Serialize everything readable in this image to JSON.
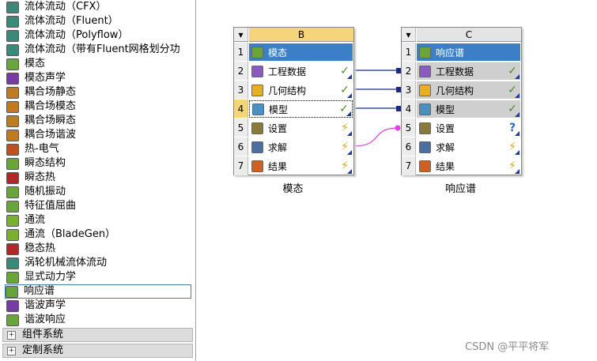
{
  "toolbox": {
    "items": [
      {
        "label": "流体流动（CFX）",
        "icon": "cfx-icon",
        "color": "#3a8a7a"
      },
      {
        "label": "流体流动（Fluent）",
        "icon": "fluent-icon",
        "color": "#3a8a7a"
      },
      {
        "label": "流体流动（Polyflow）",
        "icon": "polyflow-icon",
        "color": "#3a8a7a"
      },
      {
        "label": "流体流动（带有Fluent网格划分功",
        "icon": "fluent-mesh-icon",
        "color": "#3a8a7a"
      },
      {
        "label": "模态",
        "icon": "modal-icon",
        "color": "#6aa53a"
      },
      {
        "label": "模态声学",
        "icon": "modal-acoustics-icon",
        "color": "#7a3aa5"
      },
      {
        "label": "耦合场静态",
        "icon": "coupled-static-icon",
        "color": "#c07a20"
      },
      {
        "label": "耦合场模态",
        "icon": "coupled-modal-icon",
        "color": "#c07a20"
      },
      {
        "label": "耦合场瞬态",
        "icon": "coupled-transient-icon",
        "color": "#c07a20"
      },
      {
        "label": "耦合场谐波",
        "icon": "coupled-harmonic-icon",
        "color": "#c07a20"
      },
      {
        "label": "热-电气",
        "icon": "thermal-electric-icon",
        "color": "#c05020"
      },
      {
        "label": "瞬态结构",
        "icon": "transient-structural-icon",
        "color": "#6aa53a"
      },
      {
        "label": "瞬态热",
        "icon": "transient-thermal-icon",
        "color": "#b02828"
      },
      {
        "label": "随机振动",
        "icon": "random-vibration-icon",
        "color": "#6aa53a"
      },
      {
        "label": "特征值屈曲",
        "icon": "eigenvalue-buckling-icon",
        "color": "#6aa53a"
      },
      {
        "label": "通流",
        "icon": "throughflow-icon",
        "color": "#7ab030"
      },
      {
        "label": "通流（BladeGen）",
        "icon": "throughflow-bladegen-icon",
        "color": "#7ab030"
      },
      {
        "label": "稳态热",
        "icon": "steady-thermal-icon",
        "color": "#b02828"
      },
      {
        "label": "涡轮机械流体流动",
        "icon": "turbomachinery-icon",
        "color": "#3a8a7a"
      },
      {
        "label": "显式动力学",
        "icon": "explicit-dynamics-icon",
        "color": "#6aa53a"
      },
      {
        "label": "响应谱",
        "icon": "response-spectrum-icon",
        "color": "#6aa53a"
      },
      {
        "label": "谐波声学",
        "icon": "harmonic-acoustics-icon",
        "color": "#7a3aa5"
      },
      {
        "label": "谐波响应",
        "icon": "harmonic-response-icon",
        "color": "#6aa53a"
      }
    ],
    "selected_index": 20,
    "groups": [
      {
        "label": "组件系统",
        "expander": "⊞"
      },
      {
        "label": "定制系统",
        "expander": "⊞"
      }
    ]
  },
  "systems": [
    {
      "id": "B",
      "caption": "模态",
      "header_color": "#f5d47a",
      "rows": [
        {
          "num": "1",
          "label": "模态",
          "icon": "modal-icon",
          "status": "",
          "status_color": "",
          "title": true
        },
        {
          "num": "2",
          "label": "工程数据",
          "icon": "engineering-data-icon",
          "status": "✓",
          "status_color": "#4a8a2a"
        },
        {
          "num": "3",
          "label": "几何结构",
          "icon": "geometry-icon",
          "status": "✓",
          "status_color": "#4a8a2a"
        },
        {
          "num": "4",
          "label": "模型",
          "icon": "model-icon",
          "status": "✓",
          "status_color": "#4a8a2a",
          "highlight": true,
          "dotted": true
        },
        {
          "num": "5",
          "label": "设置",
          "icon": "setup-icon",
          "status": "⚡",
          "status_color": "#e0a020"
        },
        {
          "num": "6",
          "label": "求解",
          "icon": "solution-icon",
          "status": "⚡",
          "status_color": "#e0a020"
        },
        {
          "num": "7",
          "label": "结果",
          "icon": "results-icon",
          "status": "⚡",
          "status_color": "#e0a020"
        }
      ]
    },
    {
      "id": "C",
      "caption": "响应谱",
      "header_color": "#e4e4e4",
      "rows": [
        {
          "num": "1",
          "label": "响应谱",
          "icon": "response-spectrum-icon",
          "status": "",
          "status_color": "",
          "title": true
        },
        {
          "num": "2",
          "label": "工程数据",
          "icon": "engineering-data-icon",
          "status": "✓",
          "status_color": "#4a8a2a",
          "shared": true
        },
        {
          "num": "3",
          "label": "几何结构",
          "icon": "geometry-icon",
          "status": "✓",
          "status_color": "#4a8a2a",
          "shared": true
        },
        {
          "num": "4",
          "label": "模型",
          "icon": "model-icon",
          "status": "✓",
          "status_color": "#4a8a2a",
          "shared": true
        },
        {
          "num": "5",
          "label": "设置",
          "icon": "setup-icon",
          "status": "?",
          "status_color": "#2a6ad0"
        },
        {
          "num": "6",
          "label": "求解",
          "icon": "solution-icon",
          "status": "⚡",
          "status_color": "#e0a020"
        },
        {
          "num": "7",
          "label": "结果",
          "icon": "results-icon",
          "status": "⚡",
          "status_color": "#e0a020"
        }
      ]
    }
  ],
  "colors": {
    "title_row": "#3c7fc7",
    "shared_row": "#cfcfcf",
    "link_line": "#1e2a8a",
    "solution_link": "#e040e0"
  },
  "watermark": "CSDN @平平将军"
}
